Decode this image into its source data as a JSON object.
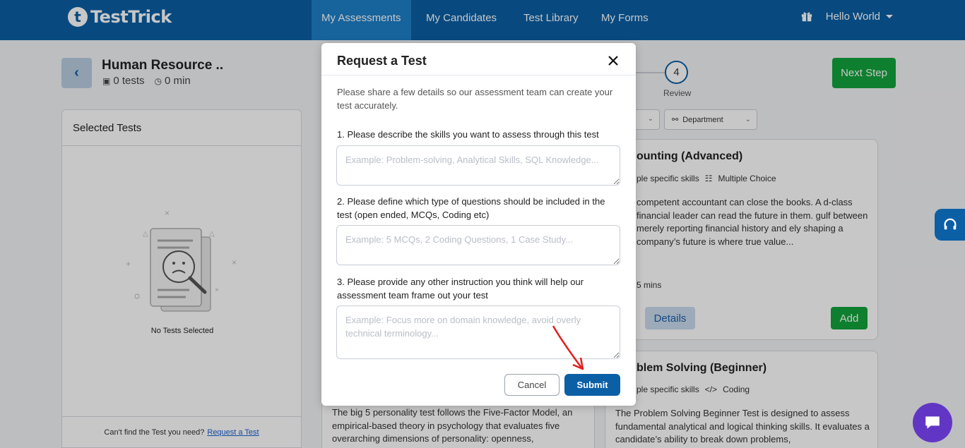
{
  "brand": {
    "logo_mark": "t",
    "name": "TestTrick"
  },
  "nav": {
    "items": [
      {
        "label": "My Assessments",
        "active": true
      },
      {
        "label": "My Candidates",
        "active": false
      },
      {
        "label": "Test Library",
        "active": false
      },
      {
        "label": "My Forms",
        "active": false
      }
    ],
    "user_greeting": "Hello World",
    "gift_icon": "gift-icon"
  },
  "header": {
    "back_icon": "‹",
    "title": "Human Resource ..",
    "tests_count": "0 tests",
    "duration": "0 min",
    "next_button": "Next Step",
    "step_number": "4",
    "step_label": "Review"
  },
  "left_panel": {
    "title": "Selected Tests",
    "empty_text": "No Tests Selected",
    "footer_text": "Can't find the Test you need?",
    "footer_link": "Request a Test"
  },
  "filters": {
    "department_label": "Department"
  },
  "cards": [
    {
      "title": "ounting (Advanced)",
      "tag_skills": "ple specific skills",
      "tag_type": "Multiple Choice",
      "description": "competent accountant can close the books. A d-class financial leader can read the future in them. gulf between merely reporting financial history and ely shaping a company’s future is where true value...",
      "duration": "5 mins",
      "details_label": "Details",
      "add_label": "Add"
    },
    {
      "title": "blem Solving (Beginner)",
      "tag_skills": "ple specific skills",
      "tag_type": "Coding",
      "description": "The Problem Solving Beginner Test is designed to assess fundamental analytical and logical thinking skills. It evaluates a candidate’s ability to break down problems,"
    },
    {
      "description": "The big 5 personality test follows the Five-Factor Model, an empirical-based theory in psychology that evaluates five overarching dimensions of personality: openness,"
    }
  ],
  "modal": {
    "title": "Request a Test",
    "intro": "Please share a few details so our assessment team can create your test accurately.",
    "questions": [
      {
        "label": "1. Please describe the skills you want to assess through this test",
        "placeholder": "Example: Problem-solving, Analytical Skills, SQL Knowledge...",
        "value": ""
      },
      {
        "label": "2. Please define which type of questions should be included in the test (open ended, MCQs, Coding etc)",
        "placeholder": "Example: 5 MCQs, 2 Coding Questions, 1 Case Study...",
        "value": ""
      },
      {
        "label": "3. Please provide any other instruction you think will help our assessment team frame out your test",
        "placeholder": "Example: Focus more on domain knowledge, avoid overly technical terminology...",
        "value": ""
      }
    ],
    "cancel_label": "Cancel",
    "submit_label": "Submit"
  },
  "colors": {
    "primary": "#0b5fa5",
    "success": "#12a33b",
    "annotation": "#e02020",
    "chat": "#6236c4"
  }
}
